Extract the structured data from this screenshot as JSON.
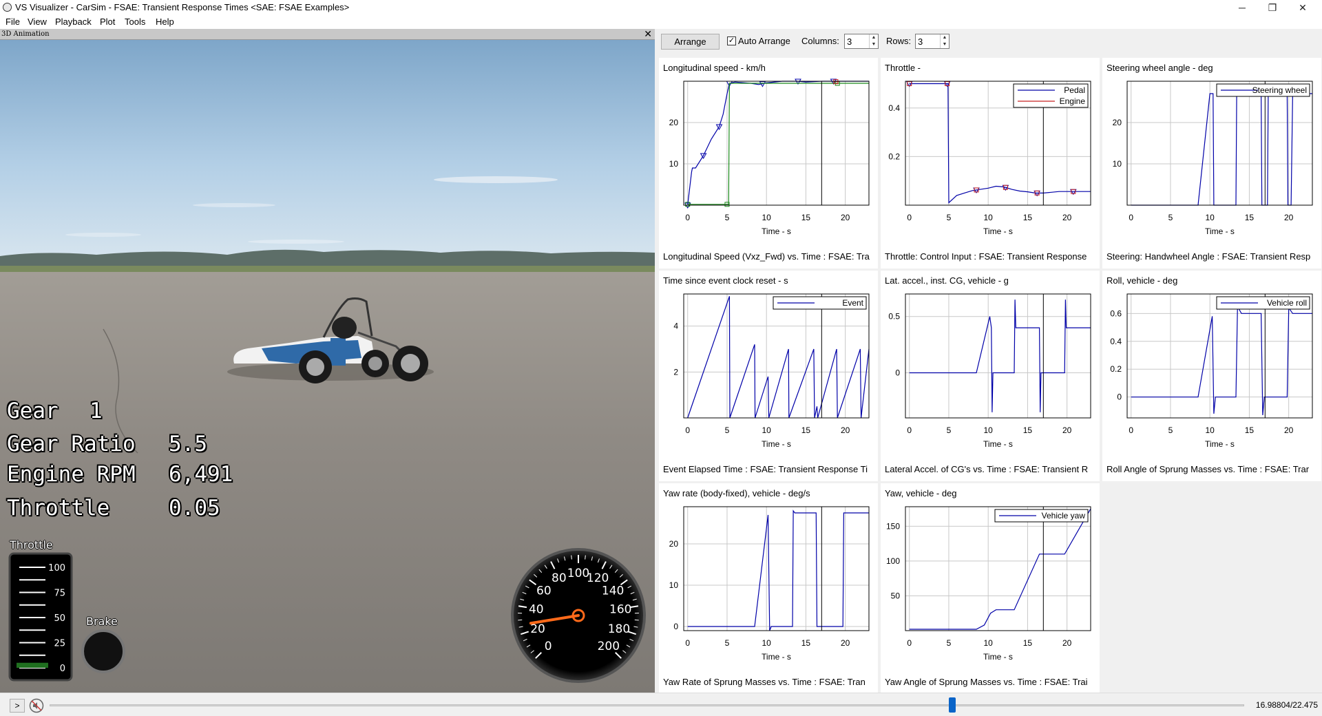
{
  "window": {
    "title": "VS Visualizer - CarSim - FSAE: Transient Response Times <SAE: FSAE Examples>",
    "minimize": "─",
    "restore": "❐",
    "close": "✕"
  },
  "menu": [
    "File",
    "View",
    "Playback",
    "Plot",
    "Tools",
    "Help"
  ],
  "animation": {
    "title": "3D Animation",
    "close_label": "✕",
    "hud": [
      {
        "label": "Gear",
        "value": "1"
      },
      {
        "label": "Gear Ratio",
        "value": "5.5"
      },
      {
        "label": "Engine RPM",
        "value": "6,491"
      },
      {
        "label": "Throttle",
        "value": "0.05"
      }
    ],
    "throttle_gauge": {
      "title": "Throttle",
      "ticks": [
        "100",
        "75",
        "50",
        "25",
        "0"
      ],
      "level": 0.05
    },
    "brake_gauge": {
      "title": "Brake"
    },
    "speedometer": {
      "ticks": [
        "0",
        "20",
        "40",
        "60",
        "80",
        "100",
        "120",
        "140",
        "160",
        "180",
        "200"
      ],
      "speed": 26.5
    }
  },
  "toolbar": {
    "arrange_label": "Arrange",
    "auto_arrange_label": "Auto Arrange",
    "auto_arrange_checked": true,
    "columns_label": "Columns:",
    "columns_value": "3",
    "rows_label": "Rows:",
    "rows_value": "3"
  },
  "playback": {
    "play_label": ">",
    "time_text": "16.98804/22.475",
    "position": 0.7559
  },
  "colors": {
    "series_blue": "#0000a8",
    "series_red": "#c82020",
    "series_green": "#1a8a1a",
    "cursor": "#000000",
    "grid": "#c8c8c8"
  },
  "chart_data": [
    {
      "type": "line",
      "title": "Longitudinal speed - km/h",
      "caption": "Longitudinal Speed (Vxz_Fwd) vs. Time : FSAE: Tra",
      "xlabel": "Time - s",
      "xlim": [
        -0.5,
        23
      ],
      "ylim": [
        0,
        30
      ],
      "xticks": [
        0,
        5,
        10,
        15,
        20
      ],
      "yticks": [
        10,
        20
      ],
      "cursor_x": 17,
      "legend": [],
      "series": [
        {
          "color": "#0000a8",
          "points": [
            [
              0,
              0
            ],
            [
              0.5,
              8
            ],
            [
              0.6,
              9
            ],
            [
              1,
              9
            ],
            [
              2,
              12
            ],
            [
              3,
              16
            ],
            [
              4,
              19
            ],
            [
              4.5,
              22
            ],
            [
              5,
              27
            ],
            [
              5.3,
              29.5
            ],
            [
              6,
              29.8
            ],
            [
              8,
              29.5
            ],
            [
              9,
              29.2
            ],
            [
              10,
              29.6
            ],
            [
              12,
              30
            ],
            [
              14,
              30
            ],
            [
              15,
              29.8
            ],
            [
              17,
              30
            ],
            [
              19,
              30
            ],
            [
              23,
              30
            ]
          ],
          "marker": "triangle",
          "marker_x": [
            0,
            2,
            4,
            5.3,
            9.5,
            14,
            18.5
          ]
        },
        {
          "color": "#1a8a1a",
          "points": [
            [
              0,
              0.2
            ],
            [
              5.2,
              0.2
            ],
            [
              5.3,
              29.5
            ],
            [
              23,
              29.5
            ]
          ],
          "marker": "square",
          "marker_x": [
            0,
            5,
            19
          ]
        },
        {
          "color": "#c82020",
          "points": [
            [
              18.5,
              29.9
            ],
            [
              19.2,
              29.9
            ]
          ],
          "marker": "square",
          "marker_x": [
            18.8
          ]
        }
      ]
    },
    {
      "type": "line",
      "title": "Throttle -",
      "caption": "Throttle: Control Input : FSAE: Transient Response",
      "xlabel": "Time - s",
      "xlim": [
        -0.5,
        23
      ],
      "ylim": [
        0,
        0.51
      ],
      "xticks": [
        0,
        5,
        10,
        15,
        20
      ],
      "yticks": [
        0.2,
        0.4
      ],
      "cursor_x": 17,
      "legend": [
        "Pedal",
        "Engine"
      ],
      "series": [
        {
          "name": "Pedal",
          "color": "#0000a8",
          "points": [
            [
              0,
              0.5
            ],
            [
              4.9,
              0.5
            ],
            [
              5,
              0.01
            ],
            [
              6,
              0.04
            ],
            [
              8,
              0.06
            ],
            [
              10,
              0.07
            ],
            [
              11,
              0.078
            ],
            [
              12,
              0.075
            ],
            [
              13,
              0.065
            ],
            [
              14,
              0.058
            ],
            [
              15,
              0.055
            ],
            [
              16,
              0.05
            ],
            [
              17,
              0.05
            ],
            [
              18,
              0.053
            ],
            [
              19,
              0.056
            ],
            [
              20,
              0.056
            ],
            [
              23,
              0.056
            ]
          ],
          "marker": "triangle",
          "marker_x": [
            0,
            4.8,
            8.5,
            12.2,
            16.2,
            20.8
          ]
        },
        {
          "name": "Engine",
          "color": "#c82020",
          "points": [],
          "marker": "square",
          "marker_x": [
            0,
            4.8,
            8.5,
            12.2,
            16.2,
            20.8
          ]
        }
      ]
    },
    {
      "type": "line",
      "title": "Steering wheel angle - deg",
      "caption": "Steering: Handwheel Angle : FSAE: Transient Resp",
      "xlabel": "Time - s",
      "xlim": [
        -0.5,
        23
      ],
      "ylim": [
        0,
        30
      ],
      "xticks": [
        0,
        5,
        10,
        15,
        20
      ],
      "yticks": [
        10,
        20
      ],
      "cursor_x": 17,
      "legend": [
        "Steering wheel"
      ],
      "series": [
        {
          "name": "Steering wheel",
          "color": "#0000a8",
          "points": [
            [
              0,
              0
            ],
            [
              8.5,
              0
            ],
            [
              10,
              27
            ],
            [
              10.4,
              27
            ],
            [
              10.5,
              0
            ],
            [
              13.3,
              0
            ],
            [
              13.4,
              27
            ],
            [
              16.5,
              27
            ],
            [
              16.6,
              0
            ],
            [
              17.3,
              0
            ],
            [
              17.4,
              27
            ],
            [
              19.8,
              27
            ],
            [
              19.9,
              0
            ],
            [
              20.3,
              0
            ],
            [
              20.5,
              27
            ],
            [
              23,
              27
            ]
          ]
        }
      ]
    },
    {
      "type": "line",
      "title": "Time since event clock reset - s",
      "caption": "Event Elapsed Time : FSAE: Transient Response Ti",
      "xlabel": "Time - s",
      "xlim": [
        -0.5,
        23
      ],
      "ylim": [
        0,
        5.4
      ],
      "xticks": [
        0,
        5,
        10,
        15,
        20
      ],
      "yticks": [
        2,
        4
      ],
      "cursor_x": 17,
      "legend": [
        "Event"
      ],
      "series": [
        {
          "name": "Event",
          "color": "#0000a8",
          "points": [
            [
              0,
              0
            ],
            [
              5.3,
              5.3
            ],
            [
              5.35,
              0
            ],
            [
              8.5,
              3.2
            ],
            [
              8.55,
              0
            ],
            [
              10.2,
              1.8
            ],
            [
              10.3,
              0
            ],
            [
              12.8,
              3
            ],
            [
              12.85,
              0
            ],
            [
              16,
              3
            ],
            [
              16.1,
              0
            ],
            [
              16.4,
              0.5
            ],
            [
              16.5,
              0
            ],
            [
              18.9,
              3
            ],
            [
              19,
              0
            ],
            [
              21.9,
              3
            ],
            [
              22,
              0
            ],
            [
              23,
              3
            ]
          ]
        }
      ]
    },
    {
      "type": "line",
      "title": "Lat. accel., inst. CG, vehicle - g",
      "caption": "Lateral Accel. of CG's vs. Time : FSAE: Transient R",
      "xlabel": "Time - s",
      "xlim": [
        -0.5,
        23
      ],
      "ylim": [
        -0.4,
        0.7
      ],
      "xticks": [
        0,
        5,
        10,
        15,
        20
      ],
      "yticks": [
        0,
        0.5
      ],
      "cursor_x": 17,
      "legend": [],
      "series": [
        {
          "color": "#0000a8",
          "points": [
            [
              0,
              0
            ],
            [
              8.5,
              0
            ],
            [
              10.2,
              0.5
            ],
            [
              10.4,
              0.4
            ],
            [
              10.5,
              -0.35
            ],
            [
              10.6,
              0
            ],
            [
              11,
              0
            ],
            [
              13.3,
              0
            ],
            [
              13.4,
              0.65
            ],
            [
              13.5,
              0.4
            ],
            [
              16,
              0.4
            ],
            [
              16.5,
              0.4
            ],
            [
              16.6,
              -0.35
            ],
            [
              16.7,
              0
            ],
            [
              19.7,
              0
            ],
            [
              19.8,
              0.65
            ],
            [
              19.9,
              0.4
            ],
            [
              23,
              0.4
            ]
          ]
        }
      ]
    },
    {
      "type": "line",
      "title": "Roll, vehicle - deg",
      "caption": "Roll Angle of Sprung Masses vs. Time : FSAE: Trar",
      "xlabel": "Time - s",
      "xlim": [
        -0.5,
        23
      ],
      "ylim": [
        -0.15,
        0.74
      ],
      "xticks": [
        0,
        5,
        10,
        15,
        20
      ],
      "yticks": [
        0,
        0.2,
        0.4,
        0.6
      ],
      "cursor_x": 17,
      "legend": [
        "Vehicle roll"
      ],
      "series": [
        {
          "name": "Vehicle roll",
          "color": "#0000a8",
          "points": [
            [
              0,
              0
            ],
            [
              8.5,
              0
            ],
            [
              10.3,
              0.58
            ],
            [
              10.5,
              -0.12
            ],
            [
              10.7,
              0
            ],
            [
              13.3,
              0
            ],
            [
              13.5,
              0.65
            ],
            [
              14,
              0.6
            ],
            [
              16.5,
              0.6
            ],
            [
              16.7,
              -0.13
            ],
            [
              16.9,
              0
            ],
            [
              19.8,
              0
            ],
            [
              20,
              0.64
            ],
            [
              20.5,
              0.6
            ],
            [
              23,
              0.6
            ]
          ]
        }
      ]
    },
    {
      "type": "line",
      "title": "Yaw rate (body-fixed), vehicle - deg/s",
      "caption": "Yaw Rate of Sprung Masses vs. Time : FSAE: Tran",
      "xlabel": "Time - s",
      "xlim": [
        -0.5,
        23
      ],
      "ylim": [
        -1,
        29
      ],
      "xticks": [
        0,
        5,
        10,
        15,
        20
      ],
      "yticks": [
        0,
        10,
        20
      ],
      "cursor_x": 17,
      "legend": [],
      "series": [
        {
          "color": "#0000a8",
          "points": [
            [
              0,
              0
            ],
            [
              8.5,
              0
            ],
            [
              10.2,
              27
            ],
            [
              10.4,
              -1
            ],
            [
              10.6,
              0
            ],
            [
              13.3,
              0
            ],
            [
              13.4,
              28
            ],
            [
              13.6,
              27.5
            ],
            [
              16.3,
              27.5
            ],
            [
              16.4,
              0
            ],
            [
              19.7,
              0
            ],
            [
              19.8,
              27.5
            ],
            [
              23,
              27.5
            ]
          ]
        }
      ]
    },
    {
      "type": "line",
      "title": "Yaw, vehicle - deg",
      "caption": "Yaw Angle of Sprung Masses vs. Time : FSAE: Trai",
      "xlabel": "Time - s",
      "xlim": [
        -0.5,
        23
      ],
      "ylim": [
        0,
        178
      ],
      "xticks": [
        0,
        5,
        10,
        15,
        20
      ],
      "yticks": [
        50,
        100,
        150
      ],
      "cursor_x": 17,
      "legend": [
        "Vehicle yaw"
      ],
      "series": [
        {
          "name": "Vehicle yaw",
          "color": "#0000a8",
          "points": [
            [
              0,
              2
            ],
            [
              8.5,
              2
            ],
            [
              9.5,
              8
            ],
            [
              10.3,
              25
            ],
            [
              11,
              30
            ],
            [
              13.3,
              30
            ],
            [
              16.5,
              110
            ],
            [
              19.7,
              110
            ],
            [
              23,
              175
            ]
          ]
        }
      ]
    }
  ]
}
